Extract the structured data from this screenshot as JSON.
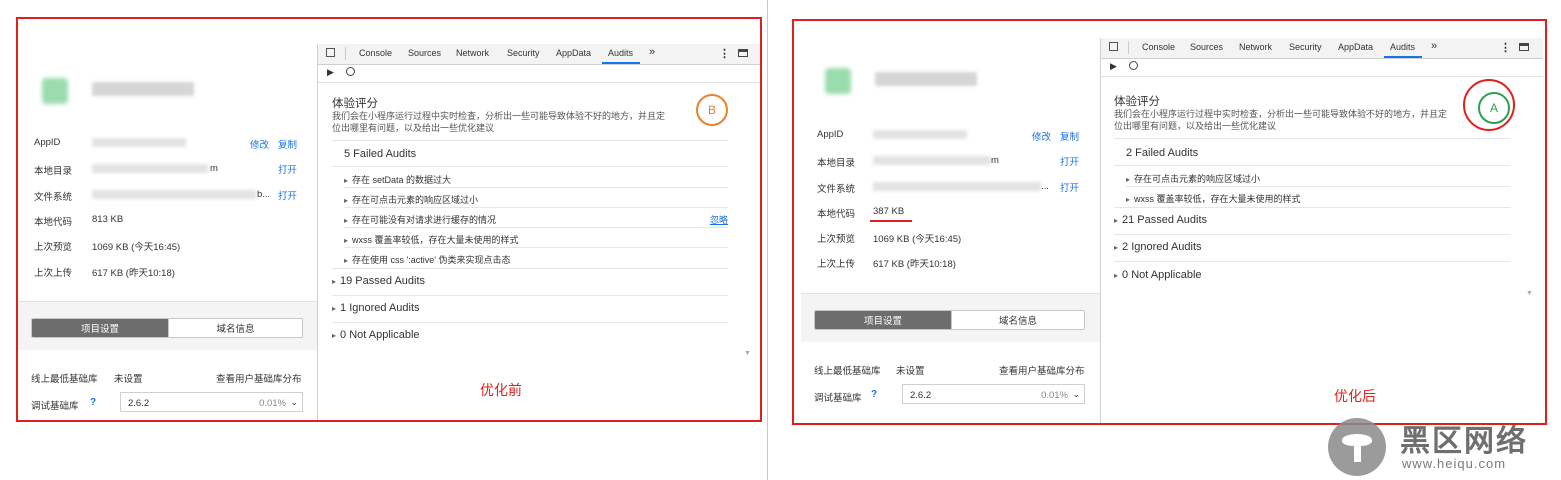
{
  "panels": {
    "before": {
      "caption": "优化前",
      "app_info": {
        "rows": [
          {
            "label": "AppID",
            "actions": [
              "修改",
              "复制"
            ]
          },
          {
            "label": "本地目录",
            "value_suffix": "m",
            "actions": [
              "打开"
            ]
          },
          {
            "label": "文件系统",
            "value_suffix": "b...",
            "actions": [
              "打开"
            ]
          },
          {
            "label": "本地代码",
            "value": "813 KB"
          },
          {
            "label": "上次预览",
            "value": "1069 KB (今天16:45)"
          },
          {
            "label": "上次上传",
            "value": "617 KB (昨天10:18)"
          }
        ]
      },
      "settings_tabs": [
        "项目设置",
        "域名信息"
      ],
      "min_lib": {
        "label": "线上最低基础库",
        "value": "未设置",
        "link": "查看用户基础库分布"
      },
      "debug_lib": {
        "label": "调试基础库",
        "help": "?",
        "version": "2.6.2",
        "percent": "0.01%"
      },
      "devtools": {
        "tabs": [
          "Console",
          "Sources",
          "Network",
          "Security",
          "AppData",
          "Audits"
        ],
        "active_tab": "Audits",
        "more": "»",
        "audit_title": "体验评分",
        "audit_desc": [
          "我们会在小程序运行过程中实时检查，分析出一些可能导致体验不好的地方，并且定",
          "位出哪里有问题，以及给出一些优化建议"
        ],
        "score": "B",
        "failed_group": "5 Failed Audits",
        "failed_items": [
          "存在 setData 的数据过大",
          "存在可点击元素的响应区域过小",
          "存在可能没有对请求进行缓存的情况",
          "wxss 覆盖率较低，存在大量未使用的样式",
          "存在使用 css ':active' 伪类来实现点击态"
        ],
        "ignore_link": "忽略",
        "other_groups": [
          "19 Passed Audits",
          "1 Ignored Audits",
          "0 Not Applicable"
        ]
      }
    },
    "after": {
      "caption": "优化后",
      "app_info": {
        "rows": [
          {
            "label": "AppID",
            "actions": [
              "修改",
              "复制"
            ]
          },
          {
            "label": "本地目录",
            "value_suffix": "m",
            "actions": [
              "打开"
            ]
          },
          {
            "label": "文件系统",
            "value_suffix": "...",
            "actions": [
              "打开"
            ]
          },
          {
            "label": "本地代码",
            "value": "387 KB"
          },
          {
            "label": "上次预览",
            "value": "1069 KB (今天16:45)"
          },
          {
            "label": "上次上传",
            "value": "617 KB (昨天10:18)"
          }
        ]
      },
      "settings_tabs": [
        "项目设置",
        "域名信息"
      ],
      "min_lib": {
        "label": "线上最低基础库",
        "value": "未设置",
        "link": "查看用户基础库分布"
      },
      "debug_lib": {
        "label": "调试基础库",
        "help": "?",
        "version": "2.6.2",
        "percent": "0.01%"
      },
      "devtools": {
        "tabs": [
          "Console",
          "Sources",
          "Network",
          "Security",
          "AppData",
          "Audits"
        ],
        "active_tab": "Audits",
        "more": "»",
        "audit_title": "体验评分",
        "audit_desc": [
          "我们会在小程序运行过程中实时检查，分析出一些可能导致体验不好的地方，并且定",
          "位出哪里有问题，以及给出一些优化建议"
        ],
        "score": "A",
        "failed_group": "2 Failed Audits",
        "failed_items": [
          "存在可点击元素的响应区域过小",
          "wxss 覆盖率较低，存在大量未使用的样式"
        ],
        "other_groups": [
          "21 Passed Audits",
          "2 Ignored Audits",
          "0 Not Applicable"
        ]
      }
    }
  },
  "watermark": {
    "brand": "黑区网络",
    "url": "www.heiqu.com"
  },
  "colors": {
    "highlight": "#e0211b",
    "link": "#1a73e8",
    "score_b": "#e8822b",
    "score_a": "#2e9e4f"
  }
}
